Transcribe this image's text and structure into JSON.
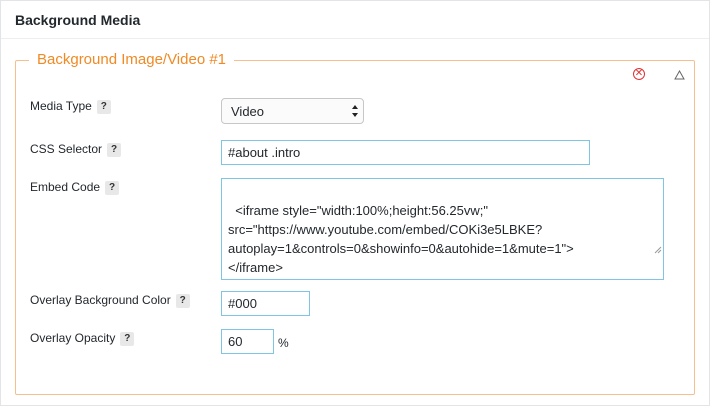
{
  "panel": {
    "title": "Background Media"
  },
  "group": {
    "legend": "Background Image/Video #1",
    "remove_icon": "remove-circle-icon",
    "collapse_icon": "triangle-up-icon"
  },
  "help_glyph": "?",
  "fields": {
    "media_type": {
      "label": "Media Type",
      "value": "Video"
    },
    "css_selector": {
      "label": "CSS Selector",
      "value": "#about .intro"
    },
    "embed_code": {
      "label": "Embed Code",
      "value": "<iframe style=\"width:100%;height:56.25vw;\"\nsrc=\"https://www.youtube.com/embed/COKi3e5LBKE?\nautoplay=1&controls=0&showinfo=0&autohide=1&mute=1\">\n</iframe>"
    },
    "overlay_color": {
      "label": "Overlay Background Color",
      "value": "#000"
    },
    "overlay_opacity": {
      "label": "Overlay Opacity",
      "value": "60",
      "unit": "%"
    }
  },
  "colors": {
    "accent": "#f08a24",
    "fieldset_border": "#f5c08e",
    "input_border": "#7ec6e4",
    "remove": "#e03131"
  }
}
